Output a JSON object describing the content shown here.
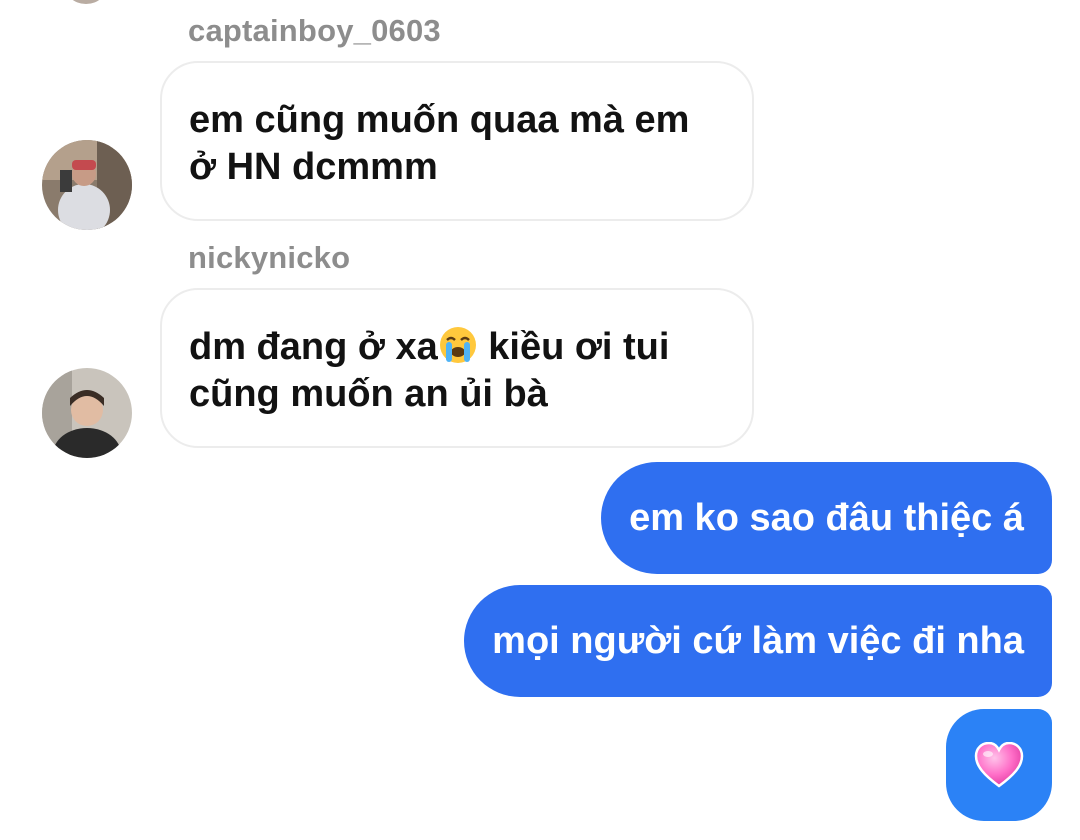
{
  "messages": [
    {
      "sender": "captainboy_0603",
      "text": "em cũng muốn quaa mà em ở HN dcmmm",
      "line1": "em cũng muốn quaa mà em",
      "line2": "ở HN dcmmm"
    },
    {
      "sender": "nickynicko",
      "line1_before": "dm đang ở xa",
      "emoji": "loudly-crying-face",
      "line1_after": " kiều ơi tui",
      "line2": "cũng muốn an ủi bà"
    },
    {
      "text": "em ko sao đâu thiệc á"
    },
    {
      "text": "mọi người cứ làm việc đi nha"
    },
    {
      "emoji": "pink-heart"
    }
  ],
  "colors": {
    "outgoing_bubble": "#2f6ff0",
    "heart_bubble": "#2b82f6",
    "incoming_border": "#ececec",
    "sender_name": "#8d8d8d"
  }
}
